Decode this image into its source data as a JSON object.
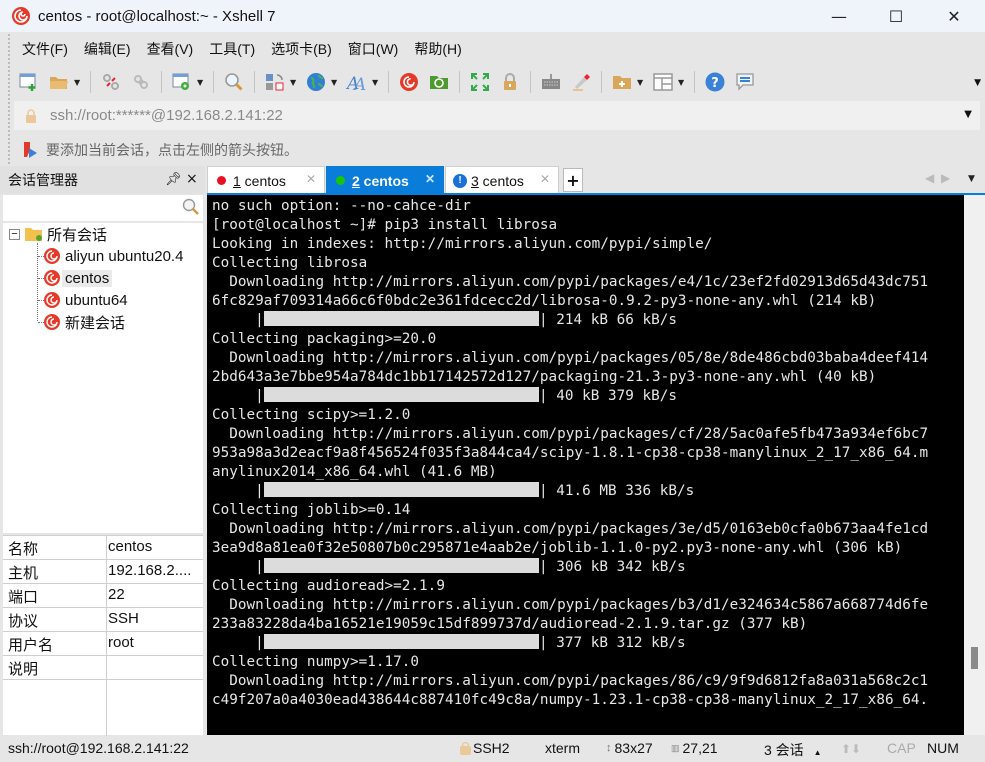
{
  "window": {
    "title": "centos - root@localhost:~ - Xshell 7",
    "controls": {
      "minimize": "—",
      "maximize": "☐",
      "close": "✕"
    }
  },
  "menu": [
    "文件(F)",
    "编辑(E)",
    "查看(V)",
    "工具(T)",
    "选项卡(B)",
    "窗口(W)",
    "帮助(H)"
  ],
  "toolbar": {
    "icons": [
      "new-session-icon",
      "open-folder-icon",
      "disconnect-icon",
      "reconnect-icon",
      "session-properties-icon",
      "find-icon",
      "transfer-icon",
      "globe-icon",
      "font-icon",
      "xshell-icon",
      "xftp-icon",
      "fullscreen-icon",
      "lock-icon",
      "keyboard-icon",
      "highlight-icon",
      "new-folder-icon",
      "layout-icon",
      "help-icon",
      "chat-icon"
    ]
  },
  "address": {
    "value": "ssh://root:******@192.168.2.141:22"
  },
  "hint": {
    "text": "要添加当前会话，点击左侧的箭头按钮。"
  },
  "session_manager": {
    "title": "会话管理器",
    "pin": "⊥",
    "close": "×",
    "search_placeholder": "",
    "root": "所有会话",
    "items": [
      {
        "label": "aliyun ubuntu20.4",
        "selected": false
      },
      {
        "label": "centos",
        "selected": true
      },
      {
        "label": "ubuntu64",
        "selected": false
      },
      {
        "label": "新建会话",
        "selected": false
      }
    ]
  },
  "properties": [
    {
      "key": "名称",
      "value": "centos"
    },
    {
      "key": "主机",
      "value": "192.168.2...."
    },
    {
      "key": "端口",
      "value": "22"
    },
    {
      "key": "协议",
      "value": "SSH"
    },
    {
      "key": "用户名",
      "value": "root"
    },
    {
      "key": "说明",
      "value": ""
    }
  ],
  "tabs": [
    {
      "num": "1",
      "label": " centos",
      "status_color": "#e81123",
      "active": false,
      "status": "disconnected"
    },
    {
      "num": "2",
      "label": " centos",
      "status_color": "#16c60c",
      "active": true,
      "status": "connected"
    },
    {
      "num": "3",
      "label": " centos",
      "status_color": "#0a64d8",
      "active": false,
      "status": "warning"
    }
  ],
  "tab_add": "+",
  "terminal": {
    "lines": [
      {
        "text": "no such option: --no-cahce-dir"
      },
      {
        "text": "[root@localhost ~]# pip3 install librosa"
      },
      {
        "text": "Looking in indexes: http://mirrors.aliyun.com/pypi/simple/"
      },
      {
        "text": "Collecting librosa"
      },
      {
        "text": "  Downloading http://mirrors.aliyun.com/pypi/packages/e4/1c/23ef2fd02913d65d43dc751"
      },
      {
        "text": "6fc829af709314a66c6f0bdc2e361fdcecc2d/librosa-0.9.2-py3-none-any.whl (214 kB)"
      },
      {
        "progress": 1.0,
        "suffix": "| 214 kB 66 kB/s"
      },
      {
        "text": "Collecting packaging>=20.0"
      },
      {
        "text": "  Downloading http://mirrors.aliyun.com/pypi/packages/05/8e/8de486cbd03baba4deef414"
      },
      {
        "text": "2bd643a3e7bbe954a784dc1bb17142572d127/packaging-21.3-py3-none-any.whl (40 kB)"
      },
      {
        "progress": 1.0,
        "suffix": "| 40 kB 379 kB/s"
      },
      {
        "text": "Collecting scipy>=1.2.0"
      },
      {
        "text": "  Downloading http://mirrors.aliyun.com/pypi/packages/cf/28/5ac0afe5fb473a934ef6bc7"
      },
      {
        "text": "953a98a3d2eacf9a8f456524f035f3a844ca4/scipy-1.8.1-cp38-cp38-manylinux_2_17_x86_64.m"
      },
      {
        "text": "anylinux2014_x86_64.whl (41.6 MB)"
      },
      {
        "progress": 1.0,
        "suffix": "| 41.6 MB 336 kB/s"
      },
      {
        "text": "Collecting joblib>=0.14"
      },
      {
        "text": "  Downloading http://mirrors.aliyun.com/pypi/packages/3e/d5/0163eb0cfa0b673aa4fe1cd"
      },
      {
        "text": "3ea9d8a81ea0f32e50807b0c295871e4aab2e/joblib-1.1.0-py2.py3-none-any.whl (306 kB)"
      },
      {
        "progress": 1.0,
        "suffix": "| 306 kB 342 kB/s"
      },
      {
        "text": "Collecting audioread>=2.1.9"
      },
      {
        "text": "  Downloading http://mirrors.aliyun.com/pypi/packages/b3/d1/e324634c5867a668774d6fe"
      },
      {
        "text": "233a83228da4ba16521e19059c15df899737d/audioread-2.1.9.tar.gz (377 kB)"
      },
      {
        "progress": 1.0,
        "suffix": "| 377 kB 312 kB/s"
      },
      {
        "text": "Collecting numpy>=1.17.0"
      },
      {
        "text": "  Downloading http://mirrors.aliyun.com/pypi/packages/86/c9/9f9d6812fa8a031a568c2c1"
      },
      {
        "text": "c49f207a0a4030ead438644c887410fc49c8a/numpy-1.23.1-cp38-cp38-manylinux_2_17_x86_64."
      }
    ]
  },
  "statusbar": {
    "connection": "ssh://root@192.168.2.141:22",
    "protocol": "SSH2",
    "term": "xterm",
    "size": "83x27",
    "cursor": "27,21",
    "sessions": "3 会话",
    "cap": "CAP",
    "num": "NUM"
  }
}
